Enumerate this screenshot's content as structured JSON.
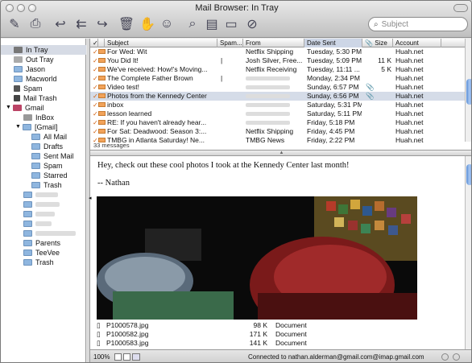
{
  "window": {
    "title": "Mail Browser: In Tray"
  },
  "toolbar": {
    "search_placeholder": "Subject"
  },
  "sidebar": {
    "items": [
      {
        "label": "In Tray",
        "icon": "inbox-icon",
        "selected": true
      },
      {
        "label": "Out Tray",
        "icon": "outbox-icon"
      },
      {
        "label": "Jason",
        "icon": "folder-icon"
      },
      {
        "label": "Macworld",
        "icon": "folder-icon"
      },
      {
        "label": "Spam",
        "icon": "spam-icon"
      },
      {
        "label": "Mail Trash",
        "icon": "trash-icon"
      },
      {
        "label": "Gmail",
        "icon": "server-icon"
      },
      {
        "label": "InBox",
        "icon": "inbox-icon"
      },
      {
        "label": "[Gmail]",
        "icon": "folder-icon"
      },
      {
        "label": "All Mail",
        "icon": "folder-icon"
      },
      {
        "label": "Drafts",
        "icon": "folder-icon"
      },
      {
        "label": "Sent Mail",
        "icon": "folder-icon"
      },
      {
        "label": "Spam",
        "icon": "folder-icon"
      },
      {
        "label": "Starred",
        "icon": "folder-icon"
      },
      {
        "label": "Trash",
        "icon": "folder-icon"
      },
      {
        "label": "",
        "icon": "folder-icon"
      },
      {
        "label": "",
        "icon": "folder-icon"
      },
      {
        "label": "",
        "icon": "folder-icon"
      },
      {
        "label": "",
        "icon": "folder-icon"
      },
      {
        "label": "",
        "icon": "folder-icon"
      },
      {
        "label": "Parents",
        "icon": "folder-icon"
      },
      {
        "label": "TeeVee",
        "icon": "folder-icon"
      },
      {
        "label": "Trash",
        "icon": "folder-icon"
      }
    ]
  },
  "list": {
    "columns": [
      "Subject",
      "Spam...",
      "From",
      "Date Sent",
      "Size",
      "Account"
    ],
    "rows": [
      {
        "subject": "For Wed: Wit",
        "spam": "",
        "from": "Netflix Shipping",
        "date": "Tuesday, 5:30 PM",
        "size": "",
        "account": "Huah.net"
      },
      {
        "subject": "You Did It!",
        "spam": "|",
        "from": "Josh Silver, Free...",
        "date": "Tuesday, 5:09 PM",
        "size": "11 K",
        "account": "Huah.net"
      },
      {
        "subject": "We've received: How!'s Moving...",
        "spam": "",
        "from": "Netflix Receiving",
        "date": "Tuesday, 11:11 ...",
        "size": "5 K",
        "account": "Huah.net"
      },
      {
        "subject": "The Complete Father Brown",
        "spam": "|",
        "from": "",
        "date": "Monday, 2:34 PM",
        "size": "",
        "account": "Huah.net"
      },
      {
        "subject": "Video test!",
        "spam": "",
        "from": "",
        "date": "Sunday, 6:57 PM",
        "size": "",
        "account": "Huah.net"
      },
      {
        "subject": "Photos from the Kennedy Center",
        "spam": "",
        "from": "",
        "date": "Sunday, 6:56 PM",
        "size": "",
        "account": "Huah.net"
      },
      {
        "subject": "inbox",
        "spam": "",
        "from": "",
        "date": "Saturday, 5:31 PM",
        "size": "",
        "account": "Huah.net"
      },
      {
        "subject": "lesson learned",
        "spam": "",
        "from": "",
        "date": "Saturday, 5:11 PM",
        "size": "",
        "account": "Huah.net"
      },
      {
        "subject": "RE: If you haven't already hear...",
        "spam": "",
        "from": "",
        "date": "Friday, 5:18 PM",
        "size": "",
        "account": "Huah.net"
      },
      {
        "subject": "For Sat: Deadwood: Season 3:...",
        "spam": "",
        "from": "Netflix Shipping",
        "date": "Friday, 4:45 PM",
        "size": "",
        "account": "Huah.net"
      },
      {
        "subject": "TMBG in Atlanta Saturday! Ne...",
        "spam": "",
        "from": "TMBG News",
        "date": "Friday, 2:22 PM",
        "size": "",
        "account": "Huah.net"
      }
    ],
    "message_count": "33 messages"
  },
  "preview": {
    "line1": "Hey, check out these cool photos I took at the Kennedy Center last month!",
    "line2": "-- Nathan",
    "attachments": [
      {
        "name": "P1000578.jpg",
        "size": "98 K",
        "kind": "Document"
      },
      {
        "name": "P1000582.jpg",
        "size": "171 K",
        "kind": "Document"
      },
      {
        "name": "P1000583.jpg",
        "size": "141 K",
        "kind": "Document"
      }
    ]
  },
  "status": {
    "zoom": "100%",
    "connection": "Connected to nathan.alderman@gmail.com@imap.gmail.com"
  }
}
